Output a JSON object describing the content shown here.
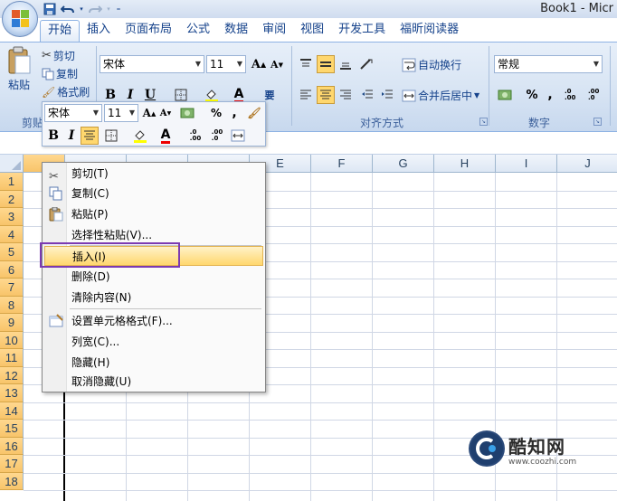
{
  "window": {
    "title": "Book1 - Micr"
  },
  "tabs": [
    {
      "label": "开始"
    },
    {
      "label": "插入"
    },
    {
      "label": "页面布局"
    },
    {
      "label": "公式"
    },
    {
      "label": "数据"
    },
    {
      "label": "审阅"
    },
    {
      "label": "视图"
    },
    {
      "label": "开发工具"
    },
    {
      "label": "福昕阅读器"
    }
  ],
  "clipboard": {
    "paste": "粘贴",
    "cut": "剪切",
    "copy": "复制",
    "format_painter": "格式刷",
    "group": "剪贴"
  },
  "font": {
    "name": "宋体",
    "size": "11",
    "bold": "B",
    "italic": "I",
    "underline": "U",
    "grow": "A",
    "shrink": "A",
    "phonetic": "要"
  },
  "alignment": {
    "wrap": "自动换行",
    "merge": "合并后居中",
    "group": "对齐方式"
  },
  "number": {
    "format": "常规",
    "percent": "%",
    "comma": ",",
    "inc_decimal": ".0 .00",
    "dec_decimal": ".00 .0",
    "group": "数字"
  },
  "mini_toolbar": {
    "font": "宋体",
    "size": "11",
    "percent": "%",
    "comma": ",",
    "bold": "B",
    "italic": "I"
  },
  "columns": [
    "E",
    "F",
    "G",
    "H",
    "I",
    "J"
  ],
  "rows": [
    "1",
    "2",
    "3",
    "4",
    "5",
    "6",
    "7",
    "8",
    "9",
    "10",
    "11",
    "12",
    "13",
    "14",
    "15",
    "16",
    "17",
    "18"
  ],
  "context_menu": {
    "items": [
      {
        "label": "剪切(T)",
        "icon": "scissors-icon"
      },
      {
        "label": "复制(C)",
        "icon": "copy-icon"
      },
      {
        "label": "粘贴(P)",
        "icon": "paste-icon"
      },
      {
        "label": "选择性粘贴(V)...",
        "icon": ""
      },
      {
        "label": "插入(I)",
        "icon": "",
        "highlighted": true
      },
      {
        "label": "删除(D)",
        "icon": ""
      },
      {
        "label": "清除内容(N)",
        "icon": ""
      },
      {
        "label": "设置单元格格式(F)...",
        "icon": "format-cells-icon"
      },
      {
        "label": "列宽(C)...",
        "icon": ""
      },
      {
        "label": "隐藏(H)",
        "icon": ""
      },
      {
        "label": "取消隐藏(U)",
        "icon": ""
      }
    ]
  },
  "watermark": {
    "name": "酷知网",
    "url": "www.coozhi.com"
  },
  "colors": {
    "highlight_frame": "#7b3ab1",
    "row_header": "#f8c46a",
    "accent": "#15428b"
  }
}
